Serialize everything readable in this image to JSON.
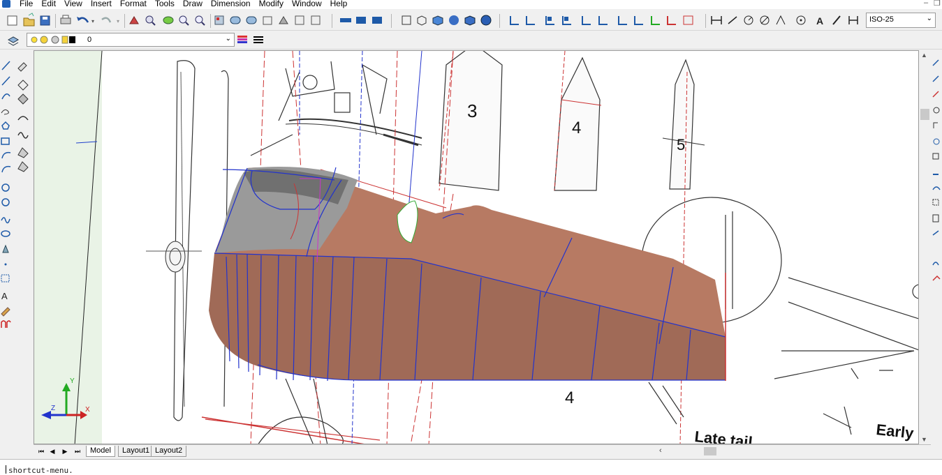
{
  "menubar": {
    "items": [
      "File",
      "Edit",
      "View",
      "Insert",
      "Format",
      "Tools",
      "Draw",
      "Dimension",
      "Modify",
      "Window",
      "Help"
    ],
    "window_controls": [
      "–",
      "❐"
    ]
  },
  "toolbar": {
    "dim_style": "ISO-25"
  },
  "layer": {
    "current": "0"
  },
  "drawing": {
    "station_labels": [
      "3",
      "4",
      "5",
      "4"
    ],
    "captions": [
      "Late tail",
      "Early"
    ],
    "ucs_axes": [
      "Y",
      "Z",
      "X"
    ]
  },
  "tabs": [
    "Model",
    "Layout1",
    "Layout2"
  ],
  "command": {
    "line": "shortcut-menu."
  },
  "colors": {
    "fuselage_skin": "#b77a63",
    "fuselage_shadow": "#a06a57",
    "canopy_gray": "#9a9a9a",
    "wire_blue": "#2233cc",
    "ref_red": "#cc2222"
  }
}
